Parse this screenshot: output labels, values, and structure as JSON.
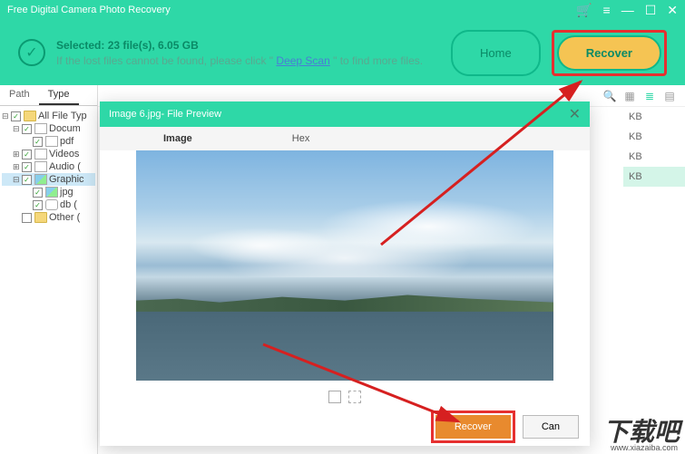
{
  "window": {
    "title": "Free Digital Camera Photo Recovery"
  },
  "header": {
    "selected_label": "Selected: 23 file(s), 6.05 GB",
    "hint_prefix": "If the lost files cannot be found, please click \" ",
    "deep_scan_label": "Deep Scan",
    "hint_suffix": " \" to find more files.",
    "home_label": "Home",
    "recover_label": "Recover"
  },
  "tabs": {
    "path": "Path",
    "type": "Type"
  },
  "tree": {
    "items": [
      {
        "label": "All File Typ",
        "indent": 0,
        "toggle": "⊟",
        "icon": "folder"
      },
      {
        "label": "Docum",
        "indent": 1,
        "toggle": "⊟",
        "icon": "doc"
      },
      {
        "label": "pdf",
        "indent": 2,
        "toggle": "",
        "icon": "doc"
      },
      {
        "label": "Videos",
        "indent": 1,
        "toggle": "⊞",
        "icon": "vid"
      },
      {
        "label": "Audio (",
        "indent": 1,
        "toggle": "⊞",
        "icon": "aud"
      },
      {
        "label": "Graphic",
        "indent": 1,
        "toggle": "⊟",
        "icon": "img",
        "selected": true
      },
      {
        "label": "jpg",
        "indent": 2,
        "toggle": "",
        "icon": "img"
      },
      {
        "label": "db (",
        "indent": 2,
        "toggle": "",
        "icon": "db"
      },
      {
        "label": "Other (",
        "indent": 1,
        "toggle": "",
        "icon": "folder"
      }
    ]
  },
  "file_list": {
    "rows": [
      {
        "size": "KB",
        "sel": false
      },
      {
        "size": "KB",
        "sel": false
      },
      {
        "size": "KB",
        "sel": false
      },
      {
        "size": "KB",
        "sel": true
      }
    ]
  },
  "preview": {
    "title": "Image 6.jpg- File Preview",
    "tab_image": "Image",
    "tab_hex": "Hex",
    "recover_label": "Recover",
    "cancel_label": "Can"
  },
  "watermark": {
    "main": "下载吧",
    "sub": "www.xiazaiba.com"
  }
}
